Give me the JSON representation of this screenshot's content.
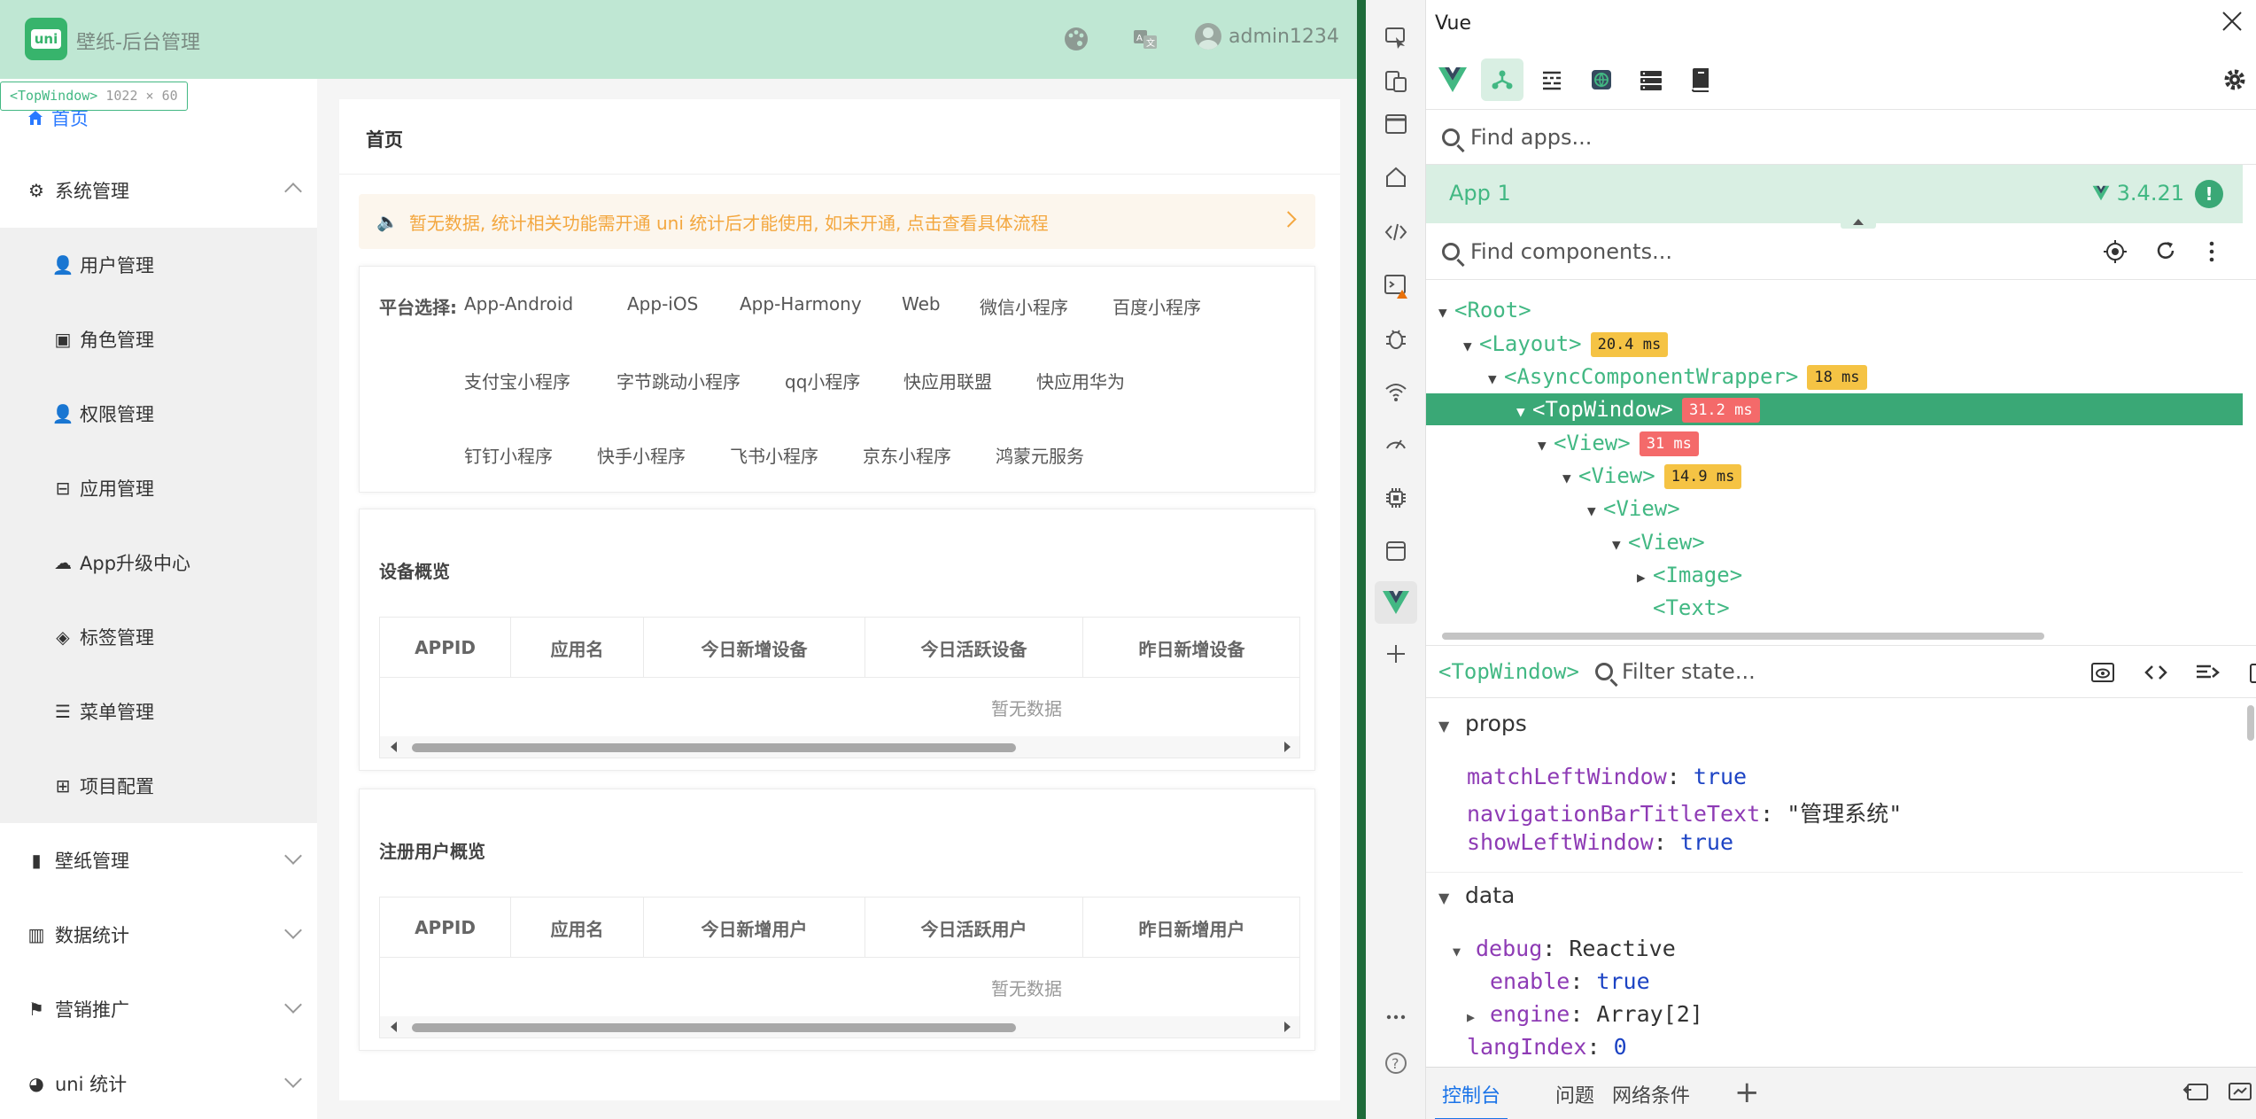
{
  "app": {
    "title": "壁纸-后台管理",
    "logo_text": "uni",
    "username": "admin1234",
    "topwindow_tag": {
      "name": "<TopWindow>",
      "size": "1022 × 60"
    },
    "home_label": "首页",
    "sidebar": [
      {
        "label": "系统管理",
        "icon": "gear-icon",
        "expanded": true
      },
      {
        "label": "用户管理",
        "icon": "user-icon",
        "sub": true
      },
      {
        "label": "角色管理",
        "icon": "role-icon",
        "sub": true
      },
      {
        "label": "权限管理",
        "icon": "key-user-icon",
        "sub": true
      },
      {
        "label": "应用管理",
        "icon": "app-icon",
        "sub": true
      },
      {
        "label": "App升级中心",
        "icon": "cloud-upload-icon",
        "sub": true
      },
      {
        "label": "标签管理",
        "icon": "tag-icon",
        "sub": true
      },
      {
        "label": "菜单管理",
        "icon": "list-icon",
        "sub": true
      },
      {
        "label": "项目配置",
        "icon": "config-icon",
        "sub": true
      },
      {
        "label": "壁纸管理",
        "icon": "wallpaper-icon",
        "expanded": false
      },
      {
        "label": "数据统计",
        "icon": "chart-icon",
        "expanded": false
      },
      {
        "label": "营销推广",
        "icon": "flag-icon",
        "expanded": false
      },
      {
        "label": "uni 统计",
        "icon": "pie-icon",
        "expanded": false
      }
    ],
    "page_title": "首页",
    "notice": "暂无数据, 统计相关功能需开通 uni 统计后才能使用, 如未开通, 点击查看具体流程",
    "platform_label": "平台选择:",
    "platforms": [
      [
        "App-Android",
        "App-iOS",
        "App-Harmony",
        "Web",
        "微信小程序",
        "百度小程序"
      ],
      [
        "支付宝小程序",
        "字节跳动小程序",
        "qq小程序",
        "快应用联盟",
        "快应用华为"
      ],
      [
        "钉钉小程序",
        "快手小程序",
        "飞书小程序",
        "京东小程序",
        "鸿蒙元服务"
      ]
    ],
    "device_section": {
      "title": "设备概览",
      "columns": [
        "APPID",
        "应用名",
        "今日新增设备",
        "今日活跃设备",
        "昨日新增设备"
      ],
      "empty_text": "暂无数据"
    },
    "user_section": {
      "title": "注册用户概览",
      "columns": [
        "APPID",
        "应用名",
        "今日新增用户",
        "今日活跃用户",
        "昨日新增用户"
      ],
      "empty_text": "暂无数据"
    },
    "colors": {
      "topbar": "#bfe7d3",
      "accent": "#2979ff",
      "notice": "#f3a73f"
    }
  },
  "devtools": {
    "title": "Vue",
    "find_apps_placeholder": "Find apps...",
    "app_name": "App 1",
    "vue_version": "3.4.21",
    "find_components_placeholder": "Find components...",
    "tree": [
      {
        "label": "<Root>",
        "depth": 0,
        "expanded": true
      },
      {
        "label": "<Layout>",
        "depth": 1,
        "expanded": true,
        "time": "20.4 ms",
        "level": "y"
      },
      {
        "label": "<AsyncComponentWrapper>",
        "depth": 2,
        "expanded": true,
        "time": "18 ms",
        "level": "y"
      },
      {
        "label": "<TopWindow>",
        "depth": 3,
        "expanded": true,
        "time": "31.2 ms",
        "level": "r",
        "selected": true
      },
      {
        "label": "<View>",
        "depth": 4,
        "expanded": true,
        "time": "31 ms",
        "level": "r"
      },
      {
        "label": "<View>",
        "depth": 5,
        "expanded": true,
        "time": "14.9 ms",
        "level": "y"
      },
      {
        "label": "<View>",
        "depth": 6,
        "expanded": true
      },
      {
        "label": "<View>",
        "depth": 7,
        "expanded": true
      },
      {
        "label": "<Image>",
        "depth": 8,
        "expanded": false
      },
      {
        "label": "<Text>",
        "depth": 8,
        "leaf": true
      }
    ],
    "selected_component": "<TopWindow>",
    "filter_state_placeholder": "Filter state...",
    "props_label": "props",
    "props": [
      {
        "key": "matchLeftWindow",
        "value": "true",
        "type": "bool"
      },
      {
        "key": "navigationBarTitleText",
        "value": "\"管理系统\"",
        "type": "str"
      },
      {
        "key": "showLeftWindow",
        "value": "true",
        "type": "bool"
      }
    ],
    "data_label": "data",
    "data": [
      {
        "key": "debug",
        "value": "Reactive",
        "type": "str",
        "depth": 0,
        "expanded": true
      },
      {
        "key": "enable",
        "value": "true",
        "type": "bool",
        "depth": 1
      },
      {
        "key": "engine",
        "value": "Array[2]",
        "type": "str",
        "depth": 1,
        "collapsed": true
      },
      {
        "key": "langIndex",
        "value": "0",
        "type": "num",
        "depth": 0
      }
    ],
    "bottom_tabs": [
      "控制台",
      "问题",
      "网络条件"
    ]
  }
}
